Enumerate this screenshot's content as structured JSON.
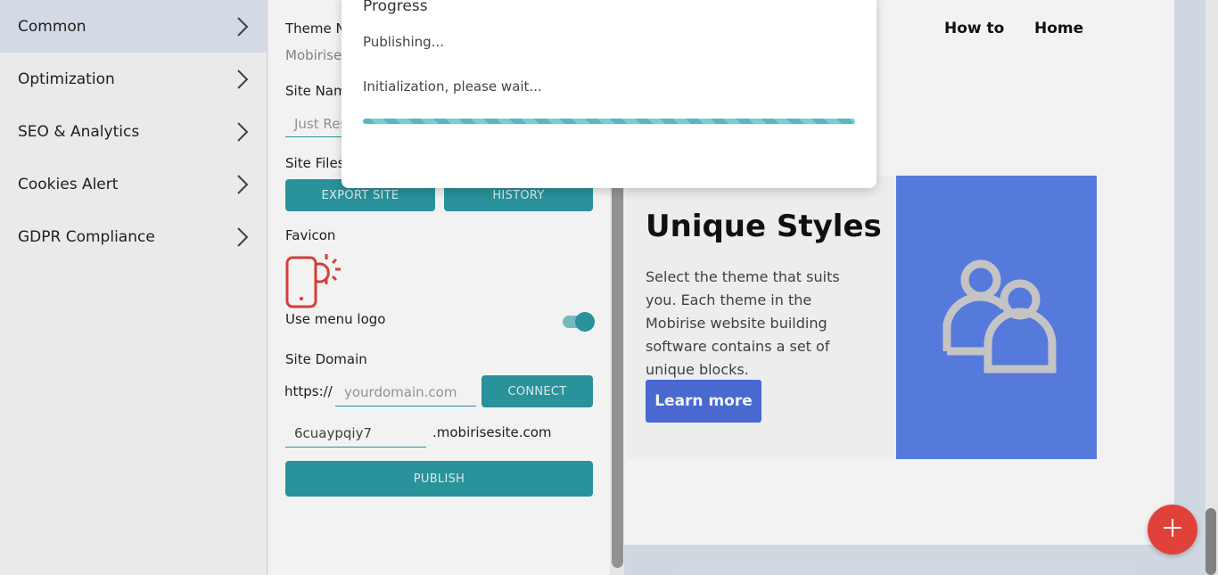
{
  "sidebar": {
    "items": [
      {
        "label": "Common",
        "active": true
      },
      {
        "label": "Optimization"
      },
      {
        "label": "SEO & Analytics"
      },
      {
        "label": "Cookies Alert"
      },
      {
        "label": "GDPR Compliance"
      }
    ]
  },
  "panel": {
    "theme_label": "Theme N",
    "theme_value": "Mobirise",
    "site_name_label": "Site Nam",
    "site_name_value": "Just Res",
    "site_files_label": "Site Files",
    "export_button": "EXPORT SITE",
    "history_button": "HISTORY",
    "favicon_label": "Favicon",
    "use_menu_logo_label": "Use menu logo",
    "use_menu_logo_on": true,
    "site_domain_label": "Site Domain",
    "https_prefix": "https://",
    "domain_placeholder": "yourdomain.com",
    "connect_button": "CONNECT",
    "subdomain_value": "6cuaypqiy7",
    "subdomain_suffix": ".mobirisesite.com",
    "publish_button": "PUBLISH"
  },
  "preview": {
    "nav": [
      "How to",
      "Home"
    ],
    "hero_title": "Unique Styles",
    "hero_text": "Select the theme that suits you. Each theme in the Mobirise website building software contains a set of unique blocks.",
    "learn_more": "Learn more",
    "image_icon": "users-icon"
  },
  "modal": {
    "title": "Progress",
    "status": "Publishing...",
    "message": "Initialization, please wait...",
    "progress": 1.0
  },
  "fab": {
    "icon": "plus-icon"
  },
  "colors": {
    "accent": "#2c9aa3",
    "hero_image": "#5b80e8",
    "button_blue": "#4d6fdc",
    "fab": "#e0423a",
    "favicon": "#e0423a"
  }
}
